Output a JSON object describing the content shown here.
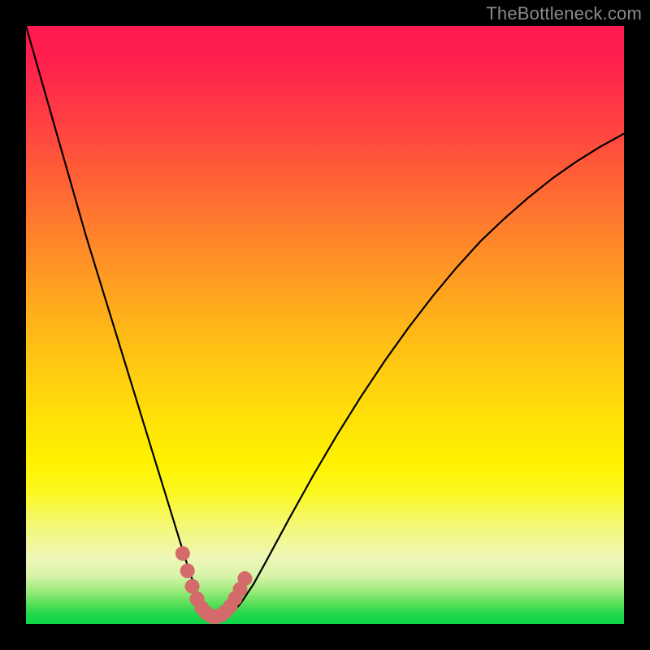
{
  "watermark": "TheBottleneck.com",
  "colors": {
    "page_bg": "#000000",
    "curve": "#000000",
    "marker": "#d46a6a",
    "watermark": "#8a8a8a",
    "gradient_top": "#ff1a50",
    "gradient_bottom": "#10d548"
  },
  "chart_data": {
    "type": "line",
    "title": "",
    "xlabel": "",
    "ylabel": "",
    "xlim": [
      0,
      100
    ],
    "ylim": [
      0,
      100
    ],
    "annotations": [],
    "series": [
      {
        "name": "bottleneck-curve",
        "x": [
          0,
          2,
          4,
          6,
          8,
          10,
          12,
          14,
          16,
          18,
          20,
          22,
          24,
          26,
          27,
          28,
          29,
          30,
          31,
          32,
          33,
          34,
          35,
          36,
          38,
          40,
          44,
          48,
          52,
          56,
          60,
          64,
          68,
          72,
          76,
          80,
          84,
          88,
          92,
          96,
          100
        ],
        "y": [
          100,
          93,
          86,
          79,
          72,
          65,
          58.5,
          52,
          45.5,
          39,
          32.5,
          26,
          19.5,
          13,
          9.8,
          6.9,
          4.4,
          2.6,
          1.6,
          1.2,
          1.2,
          1.6,
          2.4,
          3.6,
          6.6,
          10.2,
          17.6,
          24.8,
          31.6,
          38.0,
          44.0,
          49.6,
          54.8,
          59.6,
          64.0,
          67.8,
          71.3,
          74.5,
          77.3,
          79.8,
          82.0
        ]
      }
    ],
    "highlight": {
      "name": "bottleneck-minimum-region",
      "x": [
        26.2,
        27.0,
        27.8,
        28.6,
        29.4,
        30.2,
        31.0,
        31.8,
        32.6,
        33.4,
        34.2,
        35.0,
        35.8,
        36.6
      ],
      "y": [
        11.8,
        8.9,
        6.3,
        4.2,
        2.7,
        1.8,
        1.3,
        1.2,
        1.5,
        2.1,
        3.0,
        4.3,
        5.8,
        7.6
      ]
    }
  }
}
